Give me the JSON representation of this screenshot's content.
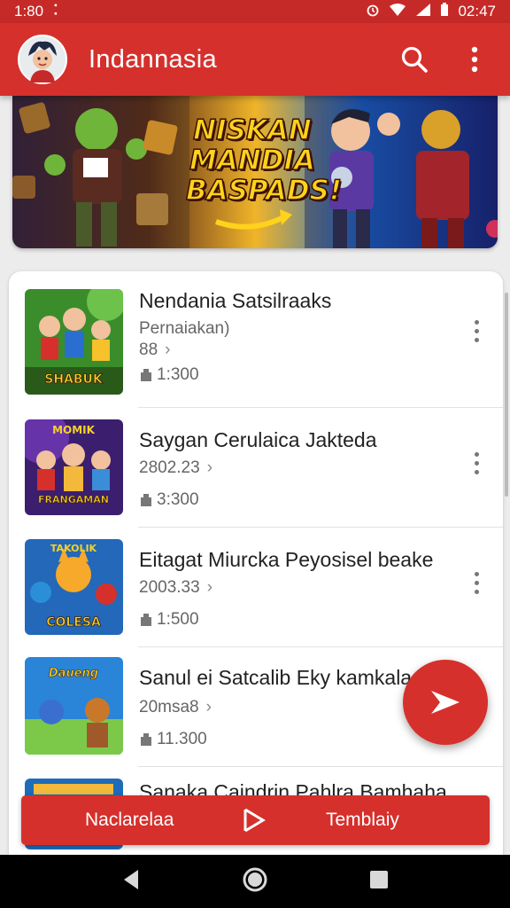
{
  "status_bar": {
    "time_left": "1:80",
    "dots": "⠅",
    "time_right": "02:47"
  },
  "app_bar": {
    "title": "Indannasia",
    "icons": [
      "avatar",
      "search-icon",
      "more-vert-icon"
    ]
  },
  "banner": {
    "line1": "NISKAN",
    "line2": "MANDIA",
    "line3": "BASPADS!"
  },
  "list": [
    {
      "title": "Nendania Satsilraaks",
      "subtitle": "Pernaiakan)",
      "sub2": "88",
      "meta": "1:300",
      "thumb_label": "SHABUK",
      "colors": [
        "#3a8d2a",
        "#6cc24a",
        "#f6c12a"
      ]
    },
    {
      "title": "Saygan Cerulaica Jakteda",
      "subtitle": "2802.23",
      "meta": "3:300",
      "thumb_label": "FRANGAMAN",
      "colors": [
        "#3b1f6e",
        "#7a3cc2",
        "#f2b93b"
      ]
    },
    {
      "title": "Eitagat Miurcka Peyosisel beake",
      "subtitle": "2003.33",
      "meta": "1:500",
      "thumb_label": "COLESA",
      "colors": [
        "#2368b9",
        "#f6a92a",
        "#2a8fd7"
      ]
    },
    {
      "title": "Sanul ei Satcalib Eky kamkala",
      "subtitle": "20msa8",
      "meta": "11.300",
      "thumb_label": "Daueng",
      "colors": [
        "#2a84d8",
        "#7cc94a",
        "#e9a22a"
      ]
    },
    {
      "title": "Sanaka Caindrin Pahlra Bamhaha",
      "subtitle": "",
      "meta": "",
      "thumb_label": "",
      "colors": [
        "#1e6bb8",
        "#f2b93b",
        "#2a84d8"
      ]
    }
  ],
  "bottom_action": {
    "left_label": "Naclarelaa",
    "right_label": "Temblaiy"
  },
  "accent_color": "#d6302c"
}
